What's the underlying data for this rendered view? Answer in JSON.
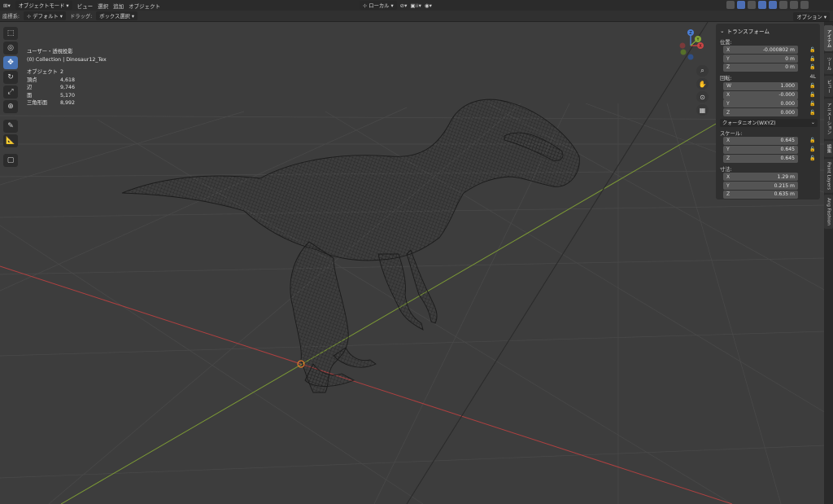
{
  "topbar": {
    "mode": "オブジェクトモード",
    "menus": [
      "ビュー",
      "選択",
      "追加",
      "オブジェクト"
    ],
    "transform_orientation": "ローカル"
  },
  "header": {
    "coord_label": "座標系:",
    "coord_value": "デフォルト",
    "drag_label": "ドラッグ:",
    "drag_value": "ボックス選択",
    "options": "オプション"
  },
  "overlay_info": {
    "view_name": "ユーザー・透視投影",
    "collection": "(0) Collection | Dinosaur12_Tex",
    "stats": [
      {
        "label": "オブジェクト",
        "value": "2"
      },
      {
        "label": "頂点",
        "value": "4,618"
      },
      {
        "label": "辺",
        "value": "9,746"
      },
      {
        "label": "面",
        "value": "5,170"
      },
      {
        "label": "三角形面",
        "value": "8,992"
      }
    ]
  },
  "gizmo": {
    "x": "X",
    "y": "Y",
    "z": "Z"
  },
  "transform_panel": {
    "title": "トランスフォーム",
    "location_label": "位置:",
    "location": [
      {
        "axis": "X",
        "value": "-0.000802 m"
      },
      {
        "axis": "Y",
        "value": "0 m"
      },
      {
        "axis": "Z",
        "value": "0 m"
      }
    ],
    "rotation_label": "回転:",
    "rotation_mode_tag": "4L",
    "rotation": [
      {
        "axis": "W",
        "value": "1.000"
      },
      {
        "axis": "X",
        "value": "-0.000"
      },
      {
        "axis": "Y",
        "value": "0.000"
      },
      {
        "axis": "Z",
        "value": "0.000"
      }
    ],
    "rotation_mode": "クォータニオン(WXYZ)",
    "scale_label": "スケール:",
    "scale": [
      {
        "axis": "X",
        "value": "0.645"
      },
      {
        "axis": "Y",
        "value": "0.645"
      },
      {
        "axis": "Z",
        "value": "0.645"
      }
    ],
    "dimensions_label": "寸法:",
    "dimensions": [
      {
        "axis": "X",
        "value": "1.29 m"
      },
      {
        "axis": "Y",
        "value": "0.215 m"
      },
      {
        "axis": "Z",
        "value": "0.635 m"
      }
    ]
  },
  "side_tabs": [
    "アイテム",
    "ツール",
    "ビュー",
    "アニメーション",
    "編集",
    "Paint Layers",
    "Ang Fashion"
  ],
  "colors": {
    "accent": "#4772b3",
    "x_axis": "#c94545",
    "y_axis": "#86a838",
    "z_axis": "#4b7fd6"
  }
}
